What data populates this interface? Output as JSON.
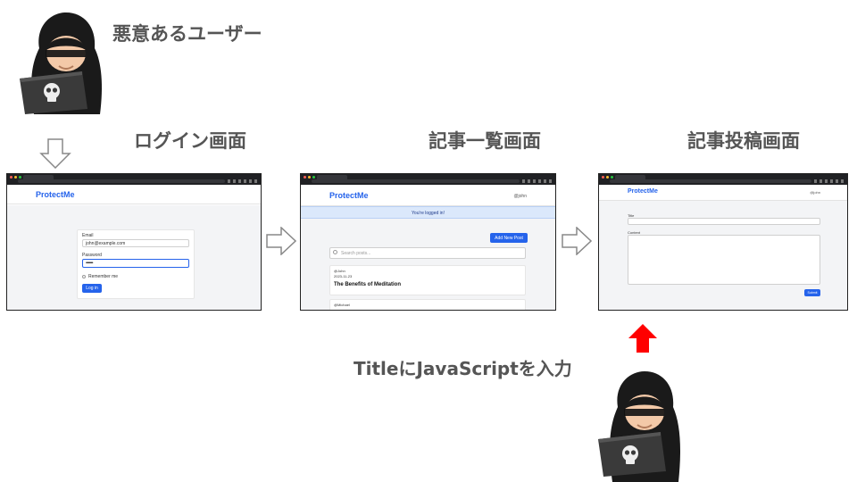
{
  "labels": {
    "malicious_user": "悪意あるユーザー",
    "login_screen": "ログイン画面",
    "article_list_screen": "記事一覧画面",
    "article_post_screen": "記事投稿画面",
    "inject_note": "TitleにJavaScriptを入力"
  },
  "login": {
    "brand": "ProtectMe",
    "email_label": "Email",
    "email_value": "john@example.com",
    "password_label": "Password",
    "password_value": "••••••••••",
    "remember_label": "Remember me",
    "login_button": "Log in"
  },
  "list": {
    "brand": "ProtectMe",
    "user": "@john",
    "banner": "You're logged in!",
    "add_button": "Add New Post",
    "search_placeholder": "Search posts...",
    "posts": [
      {
        "author": "@John",
        "date": "2023-11-23",
        "title": "The Benefits of Meditation"
      },
      {
        "author": "@Michael",
        "date": "",
        "title": ""
      }
    ]
  },
  "post": {
    "brand": "ProtectMe",
    "user": "@john",
    "title_label": "Title",
    "content_label": "Content",
    "submit_button": "Submit"
  },
  "colors": {
    "brand": "#2563eb",
    "highlight_arrow": "#ff0000",
    "banner_bg": "#dbe8fb"
  },
  "icons": [
    "hacker-illustration",
    "skull-icon",
    "flow-arrow-icon",
    "search-icon"
  ]
}
